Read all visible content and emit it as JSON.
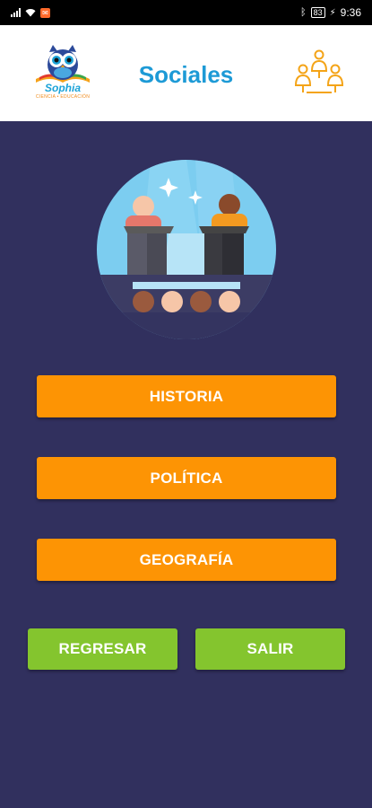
{
  "status_bar": {
    "time": "9:36",
    "battery": "83"
  },
  "header": {
    "title": "Sociales",
    "logo_text": "Sophia",
    "logo_subtext": "CIENCIA • EDUCACIÓN"
  },
  "menu": {
    "items": [
      {
        "label": "HISTORIA"
      },
      {
        "label": "POLÍTICA"
      },
      {
        "label": "GEOGRAFÍA"
      }
    ]
  },
  "actions": {
    "back_label": "REGRESAR",
    "exit_label": "SALIR"
  },
  "colors": {
    "background": "#31305e",
    "header_bg": "#ffffff",
    "title": "#1d9ad6",
    "primary_button": "#fd9404",
    "secondary_button": "#84c52e"
  },
  "icons": {
    "logo": "owl-logo-icon",
    "header_right": "team-icon",
    "illustration": "debate-illustration-icon"
  }
}
